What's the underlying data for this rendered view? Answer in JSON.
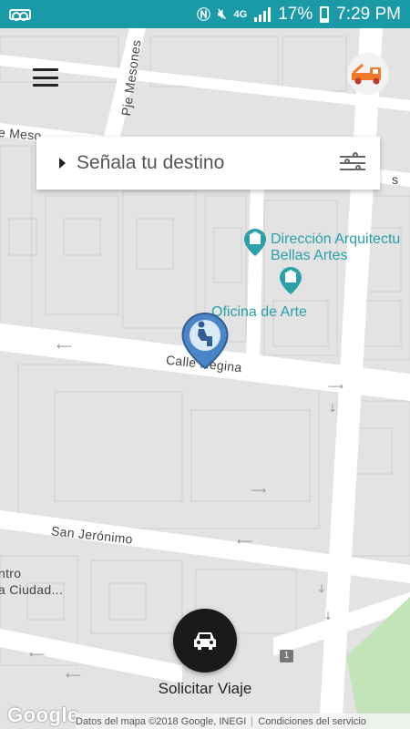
{
  "status_bar": {
    "icons": [
      "voicemail-icon",
      "nfc-icon",
      "mute-icon",
      "4g-icon",
      "signal-icon"
    ],
    "network_label": "4G",
    "battery_percent": "17%",
    "time": "7:29 PM",
    "color": "#1a9aa7"
  },
  "map": {
    "streets": {
      "mesones": "Pje Mesones",
      "mesones_left": "e Meso",
      "regina": "Calle Regina",
      "san_jeronimo": "San Jerónimo",
      "centro_1": "ntro",
      "centro_2": "a Ciudad...",
      "right_s": "s"
    },
    "pois": {
      "direccion_1": "Dirección Arquitectu",
      "direccion_2": "Bellas Artes",
      "oficina": "Oficina de Arte"
    },
    "route_number": "1",
    "google_logo": "Google",
    "attribution": "Datos del mapa ©2018 Google, INEGI",
    "terms": "Condiciones del servicio"
  },
  "header": {
    "menu_icon": "hamburger-menu-icon",
    "brand_icon": "tow-truck-icon"
  },
  "destination": {
    "label": "Señala tu destino",
    "filter_icon": "sliders-icon"
  },
  "pin_icon": "person-pin-icon",
  "ride_button": {
    "icon": "car-icon",
    "label": "Solicitar Viaje",
    "color": "#1a1a1a"
  }
}
